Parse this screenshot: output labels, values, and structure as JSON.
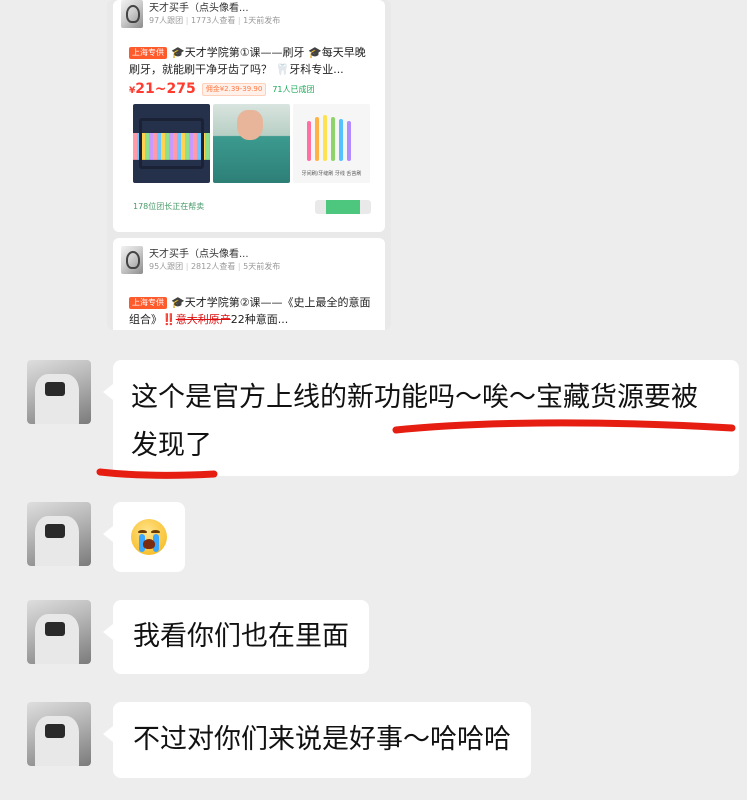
{
  "shared_screenshot": {
    "card1": {
      "author": "天才买手（点头像看...",
      "stats": [
        "97人跟团",
        "1773人查看",
        "1天前发布"
      ],
      "shop_tag": "上海专供",
      "post_text": "🎓天才学院第①课——刷牙 🎓每天早晚刷牙，就能刷干净牙齿了吗？ 🦷牙科专业...",
      "price": "21~275",
      "price_symbol": "¥",
      "commission": "佣金¥2.39-39.90",
      "buy_count": "71人已成团",
      "tools_caption": "牙间刷/牙缝刷 牙线 舌苔刷",
      "helper_text": "178位团长正在帮卖"
    },
    "card2": {
      "author": "天才买手（点头像看...",
      "stats": [
        "95人跟团",
        "2812人查看",
        "5天前发布"
      ],
      "shop_tag": "上海专供",
      "post_text_a": "🎓天才学院第②课——《史上最全的意面组合》‼️",
      "post_text_strike": "意大利原产",
      "post_text_b": "22种意面..."
    }
  },
  "messages": [
    {
      "text": "这个是官方上线的新功能吗～唉～宝藏货源要被发现了"
    },
    {
      "emoji": "crying-face"
    },
    {
      "text": "我看你们也在里面"
    },
    {
      "text": "不过对你们来说是好事～哈哈哈"
    }
  ],
  "colors": {
    "chat_background": "#ededed",
    "bubble": "#ffffff",
    "annotation_red": "#e61e12",
    "price_red": "#ff3b2f",
    "tag_orange": "#ff5a2c"
  }
}
